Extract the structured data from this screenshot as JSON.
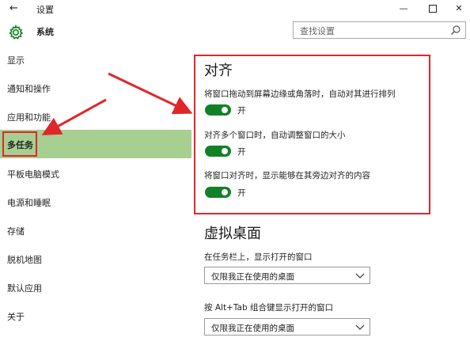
{
  "titlebar": {
    "back_glyph": "←",
    "title": "设置",
    "minimize_glyph": "—",
    "close_glyph": "✕"
  },
  "header": {
    "icon": "gear-icon",
    "title": "系统",
    "search_placeholder": "查找设置",
    "search_icon": "search-icon"
  },
  "sidebar": {
    "items": [
      {
        "label": "显示",
        "selected": false
      },
      {
        "label": "通知和操作",
        "selected": false
      },
      {
        "label": "应用和功能",
        "selected": false
      },
      {
        "label": "多任务",
        "selected": true
      },
      {
        "label": "平板电脑模式",
        "selected": false
      },
      {
        "label": "电源和睡眠",
        "selected": false
      },
      {
        "label": "存储",
        "selected": false
      },
      {
        "label": "脱机地图",
        "selected": false
      },
      {
        "label": "默认应用",
        "selected": false
      },
      {
        "label": "关于",
        "selected": false
      }
    ]
  },
  "snap": {
    "heading": "对齐",
    "options": [
      {
        "label": "将窗口拖动到屏幕边缘或角落时，自动对其进行排列",
        "state": "开",
        "on": true
      },
      {
        "label": "对齐多个窗口时，自动调整窗口的大小",
        "state": "开",
        "on": true
      },
      {
        "label": "将窗口对齐时，显示能够在其旁边对齐的内容",
        "state": "开",
        "on": true
      }
    ]
  },
  "virtual_desktops": {
    "heading": "虚拟桌面",
    "taskbar_label": "在任务栏上，显示打开的窗口",
    "taskbar_value": "仅限我正在使用的桌面",
    "alttab_label": "按 Alt+Tab 组合键显示打开的窗口",
    "alttab_value": "仅限我正在使用的桌面"
  },
  "colors": {
    "accent_green": "#128027",
    "selected_bg": "#a6cf91",
    "annotation_red": "#e0262b"
  }
}
